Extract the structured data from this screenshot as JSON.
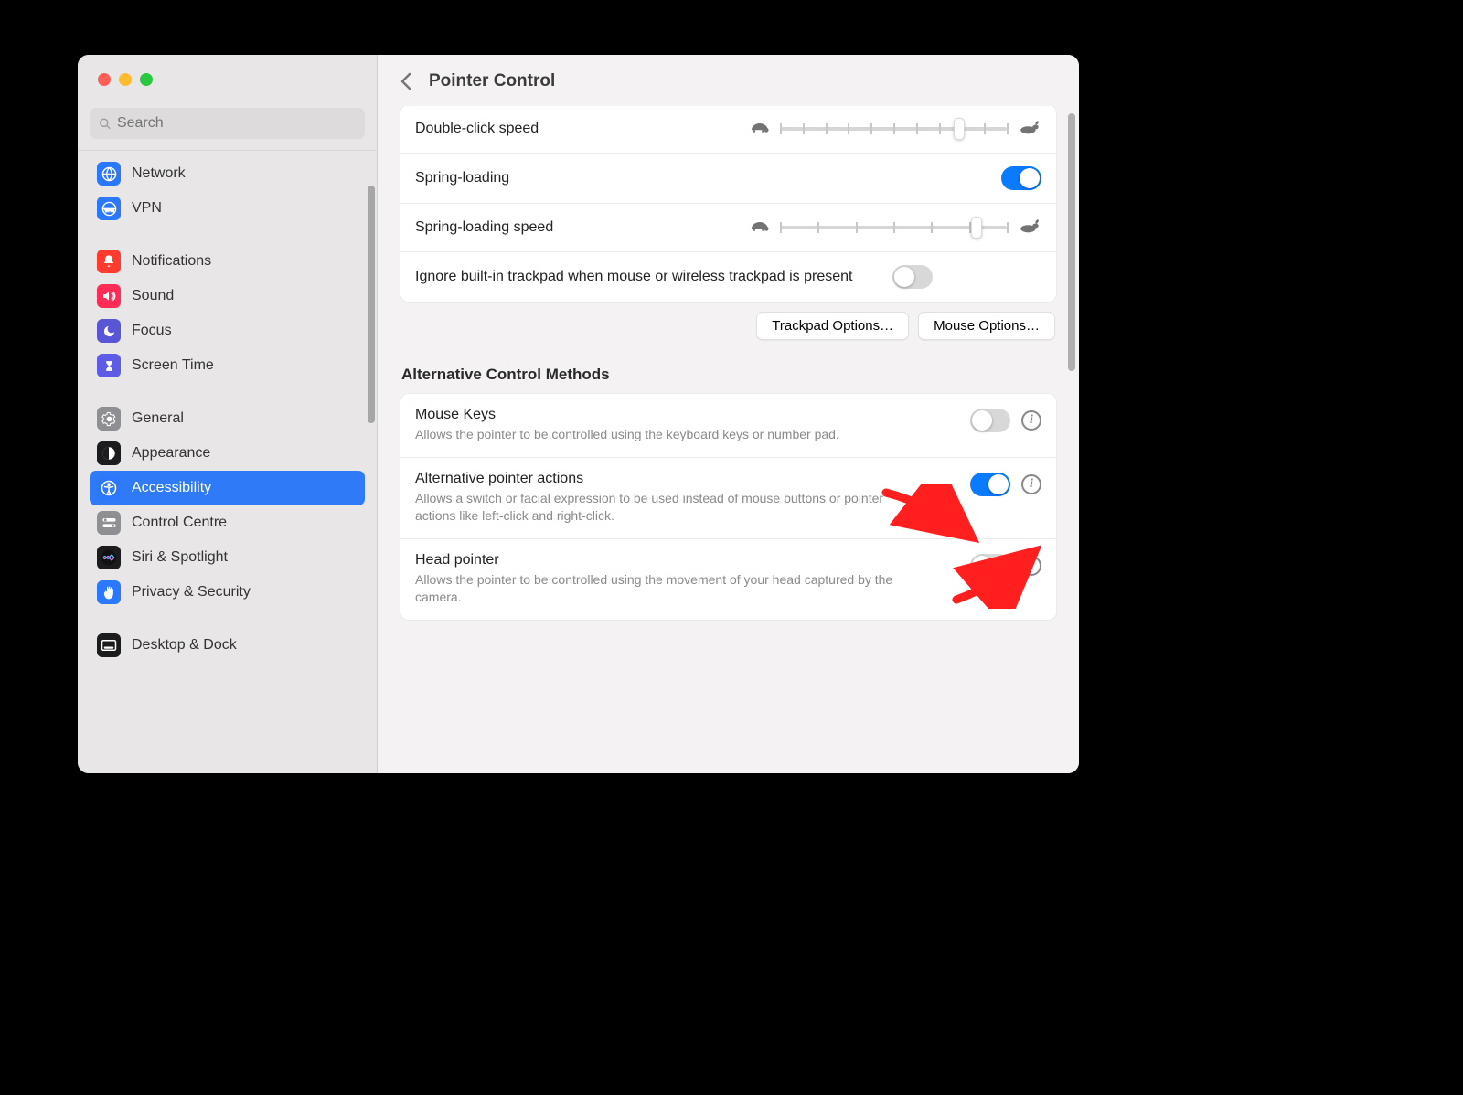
{
  "window": {
    "search_placeholder": "Search",
    "title": "Pointer Control"
  },
  "sidebar": {
    "groups": [
      {
        "items": [
          {
            "id": "network",
            "label": "Network",
            "icon": "globe-icon",
            "color": "ic-blue"
          },
          {
            "id": "vpn",
            "label": "VPN",
            "icon": "vpn-icon",
            "color": "ic-blue2"
          }
        ]
      },
      {
        "items": [
          {
            "id": "notifications",
            "label": "Notifications",
            "icon": "bell-icon",
            "color": "ic-red"
          },
          {
            "id": "sound",
            "label": "Sound",
            "icon": "speaker-icon",
            "color": "ic-pink"
          },
          {
            "id": "focus",
            "label": "Focus",
            "icon": "moon-icon",
            "color": "ic-purple"
          },
          {
            "id": "screentime",
            "label": "Screen Time",
            "icon": "hourglass-icon",
            "color": "ic-indigo"
          }
        ]
      },
      {
        "items": [
          {
            "id": "general",
            "label": "General",
            "icon": "gear-icon",
            "color": "ic-gray"
          },
          {
            "id": "appearance",
            "label": "Appearance",
            "icon": "appearance-icon",
            "color": "ic-black"
          },
          {
            "id": "accessibility",
            "label": "Accessibility",
            "icon": "accessibility-icon",
            "color": "ic-blue",
            "selected": true
          },
          {
            "id": "controlcentre",
            "label": "Control Centre",
            "icon": "switches-icon",
            "color": "ic-gray"
          },
          {
            "id": "siri",
            "label": "Siri & Spotlight",
            "icon": "siri-icon",
            "color": "ic-dark"
          },
          {
            "id": "privacy",
            "label": "Privacy & Security",
            "icon": "hand-icon",
            "color": "ic-hand"
          }
        ]
      },
      {
        "items": [
          {
            "id": "desktopdock",
            "label": "Desktop & Dock",
            "icon": "dock-icon",
            "color": "ic-black"
          }
        ]
      }
    ]
  },
  "main": {
    "rows": {
      "dcs": {
        "label": "Double-click speed",
        "value_pct": 80
      },
      "spring": {
        "label": "Spring-loading",
        "on": true
      },
      "sls": {
        "label": "Spring-loading speed",
        "value_pct": 88
      },
      "ignore": {
        "label": "Ignore built-in trackpad when mouse or wireless trackpad is present",
        "on": false
      }
    },
    "buttons": {
      "trackpad": "Trackpad Options…",
      "mouse": "Mouse Options…"
    },
    "alt_section_title": "Alternative Control Methods",
    "alt": [
      {
        "id": "mousekeys",
        "label": "Mouse Keys",
        "desc": "Allows the pointer to be controlled using the keyboard keys or number pad.",
        "on": false
      },
      {
        "id": "altpointer",
        "label": "Alternative pointer actions",
        "desc": "Allows a switch or facial expression to be used instead of mouse buttons or pointer actions like left-click and right-click.",
        "on": true
      },
      {
        "id": "headpointer",
        "label": "Head pointer",
        "desc": "Allows the pointer to be controlled using the movement of your head captured by the camera.",
        "on": false
      }
    ]
  },
  "colors": {
    "accent": "#0a7aff",
    "annotation": "#ff1f1f"
  }
}
